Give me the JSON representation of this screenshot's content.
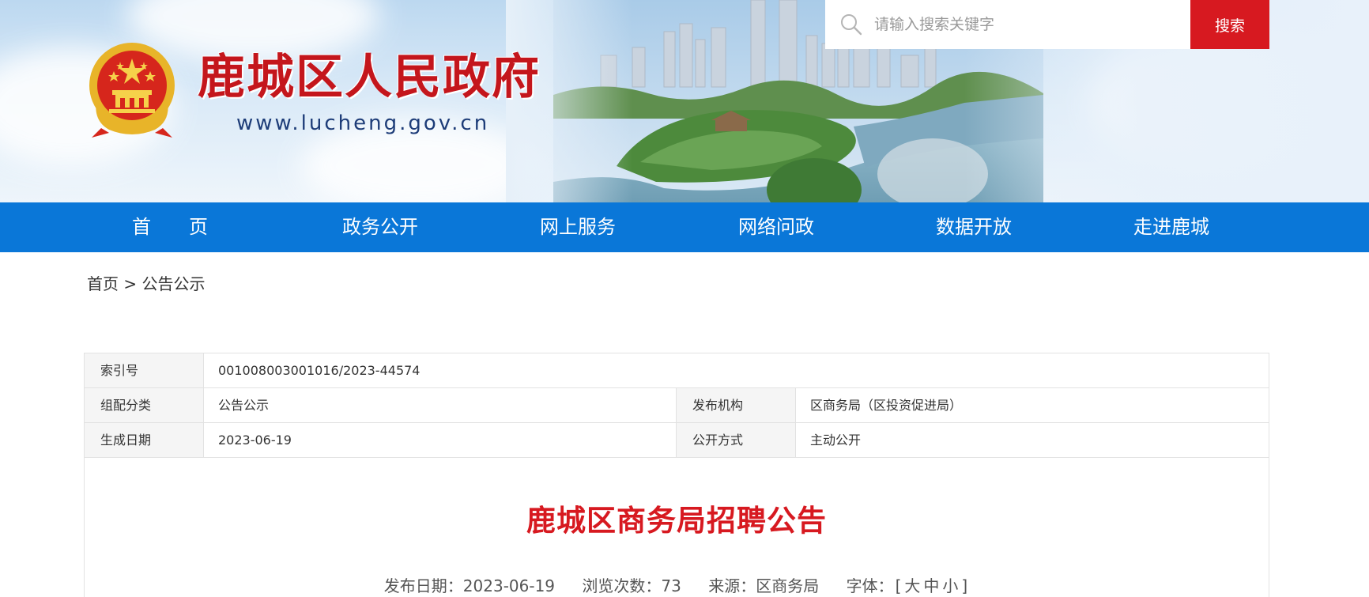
{
  "header": {
    "site_title": "鹿城区人民政府",
    "site_url": "www.lucheng.gov.cn",
    "search": {
      "placeholder": "请输入搜索关键字",
      "button_label": "搜索"
    }
  },
  "nav": {
    "items": [
      "首　　页",
      "政务公开",
      "网上服务",
      "网络问政",
      "数据开放",
      "走进鹿城"
    ]
  },
  "breadcrumb": {
    "home": "首页",
    "separator": ">",
    "current": "公告公示"
  },
  "info_table": {
    "index_label": "索引号",
    "index_value": "001008003001016/2023-44574",
    "category_label": "组配分类",
    "category_value": "公告公示",
    "publisher_label": "发布机构",
    "publisher_value": "区商务局（区投资促进局）",
    "date_label": "生成日期",
    "date_value": "2023-06-19",
    "disclosure_label": "公开方式",
    "disclosure_value": "主动公开"
  },
  "article": {
    "title": "鹿城区商务局招聘公告",
    "meta": {
      "publish_date_label": "发布日期：",
      "publish_date": "2023-06-19",
      "views_label": "浏览次数：",
      "views": "73",
      "source_label": "来源：",
      "source": "区商务局",
      "font_label": "字体：",
      "font_open": "[",
      "font_large": "大",
      "font_medium": "中",
      "font_small": "小",
      "font_close": "]"
    }
  },
  "colors": {
    "brand_red": "#d71920",
    "nav_blue": "#0a77d8",
    "title_red": "#c4161c",
    "url_blue": "#1d3c78"
  }
}
